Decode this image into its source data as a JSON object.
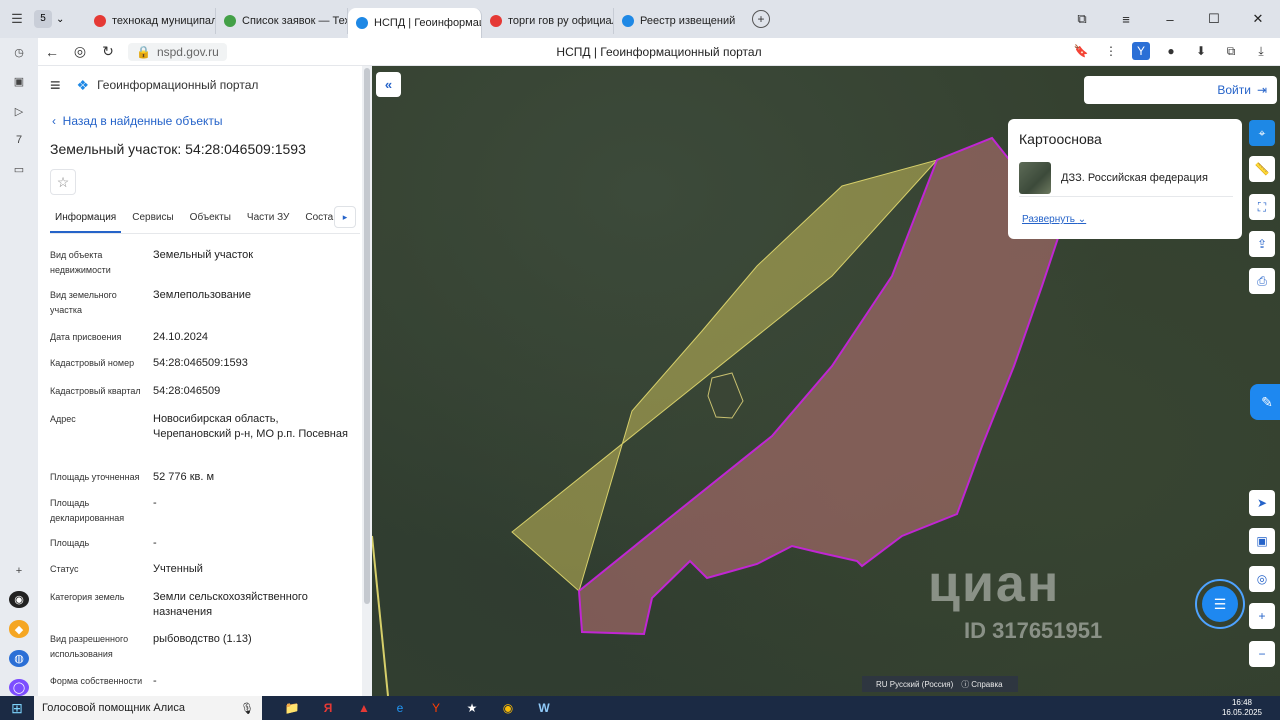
{
  "browser": {
    "tabs": [
      {
        "label": "технокад муниципалитет",
        "color": "#e53935"
      },
      {
        "label": "Список заявок — ТехноК",
        "color": "#43a047"
      },
      {
        "label": "НСПД | Геоинформаци",
        "color": "#1e88e5",
        "active": true
      },
      {
        "label": "торги гов ру официальны",
        "color": "#e53935"
      },
      {
        "label": "Реестр извещений",
        "color": "#1e88e5"
      }
    ],
    "url": "nspd.gov.ru",
    "page_title": "НСПД | Геоинформационный портал"
  },
  "portal": {
    "name": "Геоинформационный портал",
    "back_link": "Назад в найденные объекты",
    "object_title": "Земельный участок: 54:28:046509:1593",
    "tabs": [
      "Информация",
      "Сервисы",
      "Объекты",
      "Части ЗУ",
      "Соста"
    ],
    "rows": [
      {
        "label": "Вид объекта недвижимости",
        "value": "Земельный участок"
      },
      {
        "label": "Вид земельного участка",
        "value": "Землепользование"
      },
      {
        "label": "Дата присвоения",
        "value": "24.10.2024"
      },
      {
        "label": "Кадастровый номер",
        "value": "54:28:046509:1593"
      },
      {
        "label": "Кадастровый квартал",
        "value": "54:28:046509"
      },
      {
        "label": "Адрес",
        "value": "Новосибирская область, Черепановский р-н, МО р.п. Посевная"
      },
      {
        "label": "Площадь уточненная",
        "value": "52 776 кв. м"
      },
      {
        "label": "Площадь декларированная",
        "value": "-"
      },
      {
        "label": "Площадь",
        "value": "-"
      },
      {
        "label": "Статус",
        "value": "Учтенный"
      },
      {
        "label": "Категория земель",
        "value": "Земли сельскохозяйственного назначения"
      },
      {
        "label": "Вид разрешенного использования",
        "value": "рыбоводство (1.13)"
      },
      {
        "label": "Форма собственности",
        "value": "-"
      }
    ]
  },
  "map": {
    "login": "Войти",
    "basemap_title": "Картооснова",
    "basemap_item": "ДЗЗ. Российская федерация",
    "expand": "Развернуть",
    "lang": "RU Русский (Россия)",
    "help": "Справка",
    "watermark_logo": "циан",
    "watermark_id": "ID 317651951"
  },
  "taskbar": {
    "assistant": "Голосовой помощник Алиса",
    "time": "16:48",
    "date": "16.05.2025"
  }
}
